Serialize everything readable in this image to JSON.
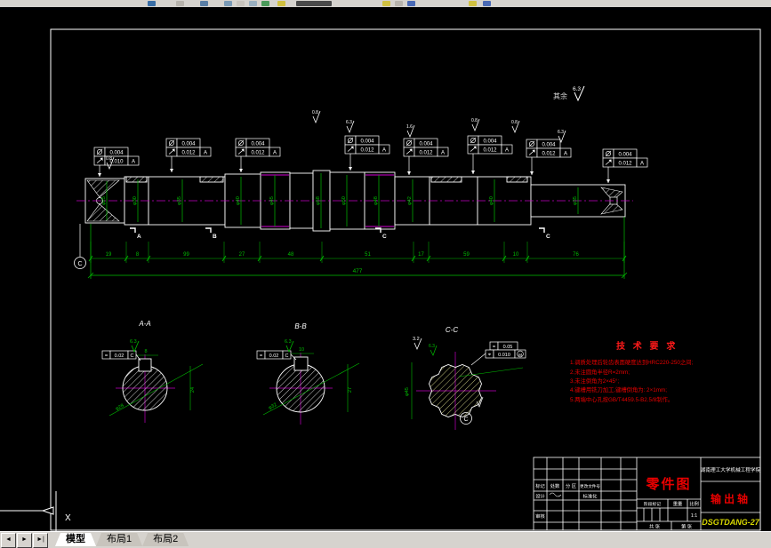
{
  "tabs": {
    "nav": [
      "◄",
      "►",
      "►|"
    ],
    "items": [
      {
        "label": "模型",
        "active": true
      },
      {
        "label": "布局1",
        "active": false
      },
      {
        "label": "布局2",
        "active": false
      }
    ]
  },
  "drawing": {
    "general_roughness": {
      "prefix": "其余",
      "value": "6.3"
    },
    "overall_length": "477",
    "chain_dims": [
      "19",
      "8",
      "99",
      "27",
      "48",
      "51",
      "17",
      "59",
      "10",
      "76"
    ],
    "diameters": [
      "φ25",
      "φ30",
      "φ35",
      "φ40",
      "φ45",
      "φ58",
      "φ50",
      "φ48",
      "φ42",
      "φ40",
      "φ35"
    ],
    "tolerance_frames": [
      {
        "top": "0.004",
        "bottom": "0.010",
        "datum": "A"
      },
      {
        "top": "0.004",
        "bottom": "0.012",
        "datum": "A"
      },
      {
        "top": "0.004",
        "bottom": "0.012",
        "datum": "A"
      },
      {
        "top": "0.004",
        "bottom": "0.012",
        "datum": "A"
      },
      {
        "top": "0.004",
        "bottom": "0.012",
        "datum": "A"
      },
      {
        "top": "0.004",
        "bottom": "0.012",
        "datum": "A"
      },
      {
        "top": "0.004",
        "bottom": "0.012",
        "datum": "A"
      },
      {
        "top": "0.004",
        "bottom": "0.012",
        "datum": "A"
      }
    ],
    "roughness_values": [
      "0.8",
      "0.8",
      "6.3",
      "1.6",
      "0.8",
      "0.8",
      "6.3"
    ],
    "cut_flags": [
      "A",
      "B",
      "C",
      "C"
    ],
    "datum_circle": "C",
    "sections": {
      "a": {
        "label": "A-A",
        "frame_sym": "=",
        "frame_value": "0.02",
        "frame_datum": "C",
        "key_width": "8",
        "depth": "24",
        "dia": "φ28",
        "rough": "6.3"
      },
      "b": {
        "label": "B-B",
        "frame_sym": "=",
        "frame_value": "0.02",
        "frame_datum": "C",
        "key_width": "10",
        "depth": "27",
        "dia": "φ32",
        "rough": "6.3"
      },
      "c": {
        "label": "C-C",
        "dia": "φ45",
        "rough_top": "3.2",
        "rough_side": "6.3",
        "frame1_sym": "=",
        "frame1_value": "0.05",
        "frame2_sym": "⌖",
        "frame2_value": "0.010",
        "frame2_mod": "M",
        "datum_circle": "C"
      }
    },
    "tech_requirements": {
      "title": "技 术 要 求",
      "lines": [
        "1.调质处理后轮齿表面硬度达到HRC220-250之间;",
        "2.未注圆角半径R=2mm;",
        "3.未注倒角为2×45°;",
        "4.键槽用铣刀加工,键槽倒角为: 2×1mm;",
        "5.两端中心孔按GB/T4459.5-B2.5/8制作。"
      ]
    },
    "title_block": {
      "part_title": "零件图",
      "org": "湖南理工大学机械工程学院",
      "part_name": "输出轴",
      "drawing_no": "DSGTDANG-27",
      "stage": "阶段标记",
      "weight": "重量",
      "scale": "比例",
      "scale_value": "1:1",
      "sheets": "共  张",
      "page": "第  张",
      "mark": "标记",
      "count": "处数",
      "zone": "分 区",
      "change_no": "更改文件号",
      "design": "设计",
      "standardize": "标准化",
      "audit": "审核"
    }
  }
}
